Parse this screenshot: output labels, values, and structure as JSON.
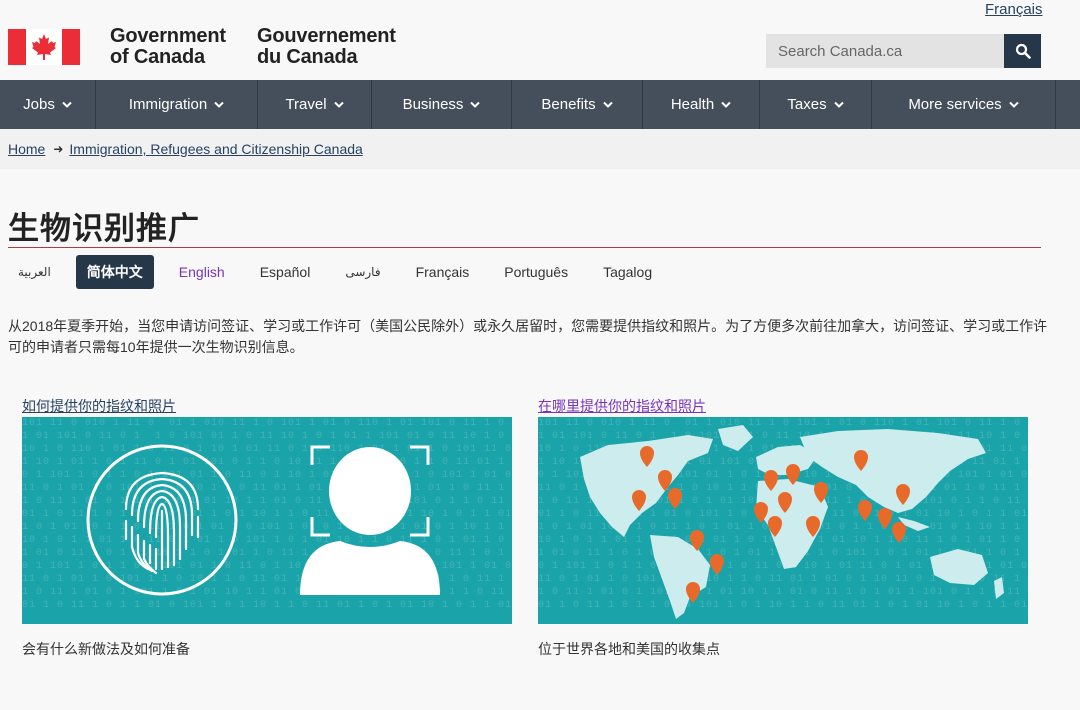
{
  "header": {
    "language_toggle": "Français",
    "signature_en_line1": "Government",
    "signature_en_line2": "of Canada",
    "signature_fr_line1": "Gouvernement",
    "signature_fr_line2": "du Canada",
    "search_placeholder": "Search Canada.ca",
    "search_icon": "search-icon",
    "colors": {
      "flag_red": "#eb2d37",
      "nav_bg": "#444f5b",
      "search_button": "#26374a"
    }
  },
  "nav": {
    "items": [
      {
        "label": "Jobs"
      },
      {
        "label": "Immigration"
      },
      {
        "label": "Travel"
      },
      {
        "label": "Business"
      },
      {
        "label": "Benefits"
      },
      {
        "label": "Health"
      },
      {
        "label": "Taxes"
      },
      {
        "label": "More services"
      }
    ]
  },
  "breadcrumb": {
    "items": [
      "Home",
      "Immigration, Refugees and Citizenship Canada"
    ]
  },
  "page": {
    "title": "生物识别推广",
    "languages": [
      "العربية",
      "简体中文",
      "English",
      "Español",
      "فارسی",
      "Français",
      "Português",
      "Tagalog"
    ],
    "active_language": "简体中文",
    "intro": "从2018年夏季开始，当您申请访问签证、学习或工作许可（美国公民除外）或永久居留时，您需要提供指纹和照片。为了方便多次前往加拿大，访问签证、学习或工作许可的申请者只需每10年提供一次生物识别信息。",
    "cards": [
      {
        "link": "如何提供你的指纹和照片",
        "caption": "会有什么新做法及如何准备"
      },
      {
        "link": "在哪里提供你的指纹和照片",
        "caption": "位于世界各地和美国的收集点"
      }
    ]
  }
}
